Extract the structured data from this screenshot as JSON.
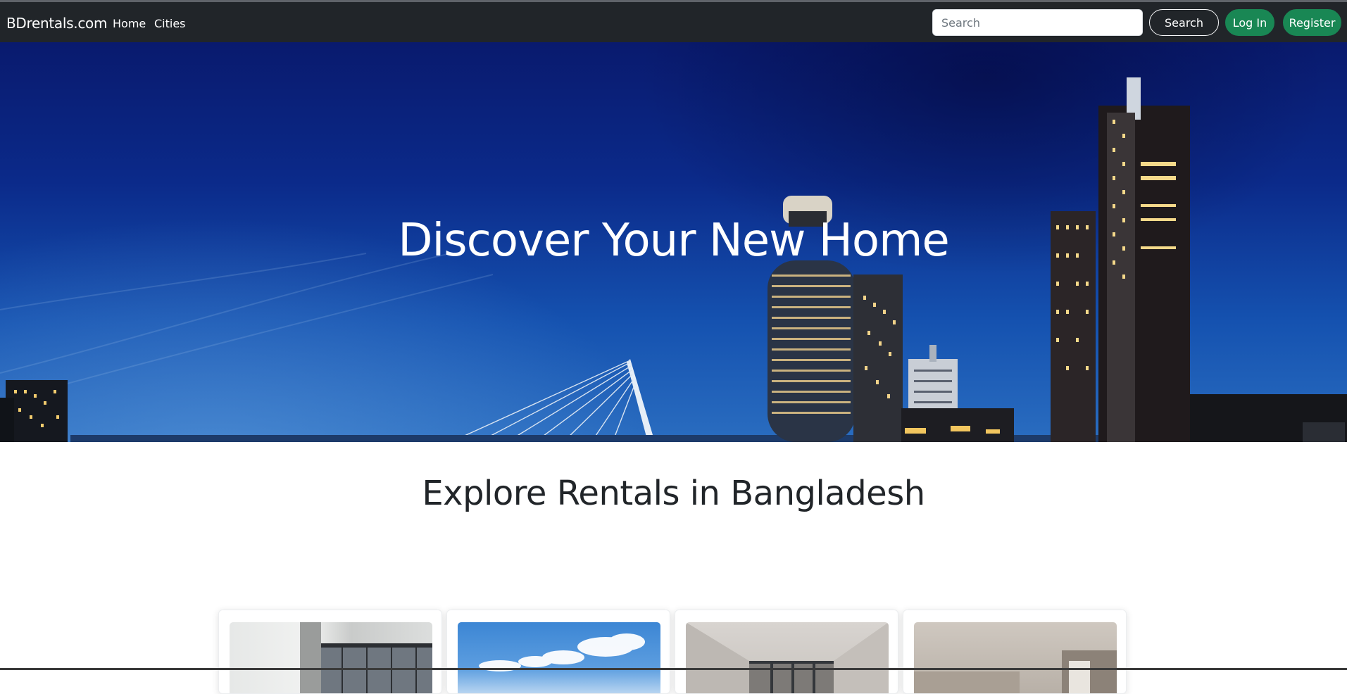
{
  "navbar": {
    "brand": "BDrentals.com",
    "links": [
      {
        "label": "Home"
      },
      {
        "label": "Cities"
      }
    ],
    "search": {
      "placeholder": "Search",
      "value": "",
      "button_label": "Search"
    },
    "login_label": "Log In",
    "register_label": "Register"
  },
  "hero": {
    "title": "Discover Your New Home"
  },
  "section": {
    "title": "Explore Rentals in Bangladesh"
  },
  "colors": {
    "navbar_bg": "#212529",
    "accent_green": "#198754",
    "hero_sky": "#0b2a8a",
    "text_dark": "#212529"
  },
  "icons": [
    "city-skyline-image",
    "apartment-photo"
  ]
}
